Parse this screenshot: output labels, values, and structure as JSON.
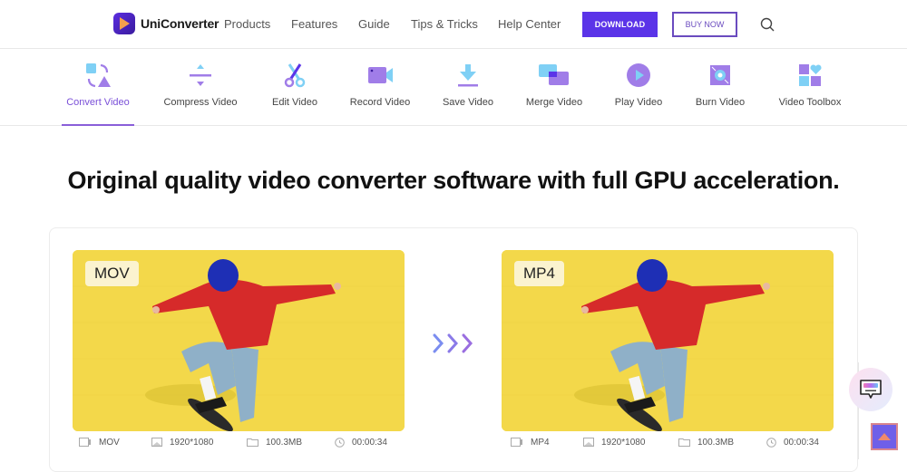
{
  "header": {
    "brand": "UniConverter",
    "nav": [
      "Products",
      "Features",
      "Guide",
      "Tips & Tricks",
      "Help Center"
    ],
    "download_label": "DOWNLOAD",
    "buy_label": "BUY NOW",
    "search_icon": "search-icon",
    "accent_color": "#5b34e8"
  },
  "tabs": [
    {
      "label": "Convert Video",
      "icon": "convert-icon",
      "active": true
    },
    {
      "label": "Compress Video",
      "icon": "compress-icon",
      "active": false
    },
    {
      "label": "Edit Video",
      "icon": "scissors-icon",
      "active": false
    },
    {
      "label": "Record Video",
      "icon": "camera-icon",
      "active": false
    },
    {
      "label": "Save Video",
      "icon": "download-icon",
      "active": false
    },
    {
      "label": "Merge Video",
      "icon": "merge-icon",
      "active": false
    },
    {
      "label": "Play Video",
      "icon": "play-icon",
      "active": false
    },
    {
      "label": "Burn Video",
      "icon": "disc-icon",
      "active": false
    },
    {
      "label": "Video Toolbox",
      "icon": "toolbox-icon",
      "active": false
    }
  ],
  "headline": "Original quality video converter software with full GPU acceleration.",
  "source": {
    "badge": "MOV",
    "format": "MOV",
    "resolution": "1920*1080",
    "size": "100.3MB",
    "duration": "00:00:34"
  },
  "target": {
    "badge": "MP4",
    "format": "MP4",
    "resolution": "1920*1080",
    "size": "100.3MB",
    "duration": "00:00:34"
  },
  "floating": {
    "chat_icon": "chat-icon",
    "back_to_top_icon": "arrow-up-icon"
  }
}
